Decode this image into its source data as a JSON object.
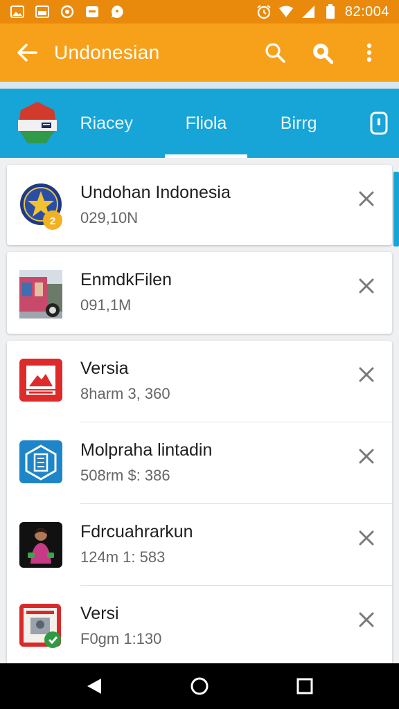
{
  "status_bar": {
    "time": "82:004",
    "left_icons": [
      "image-icon",
      "gallery-icon",
      "whatsapp-icon",
      "mail-icon",
      "chat-icon"
    ],
    "right_icons": [
      "alarm-icon",
      "wifi-icon",
      "signal-icon",
      "battery-icon"
    ]
  },
  "app_bar": {
    "title": "Undonesian",
    "back_icon": "arrow-back-icon",
    "actions": [
      "search-icon",
      "search-filled-icon",
      "more-vert-icon"
    ]
  },
  "tabs": {
    "items": [
      {
        "label": "Riacey"
      },
      {
        "label": "Fliola",
        "selected": true
      },
      {
        "label": "Birrg"
      }
    ]
  },
  "cards": [
    {
      "items": [
        {
          "title": "Undohan Indonesia",
          "subtitle": "029,10N",
          "icon": "indonesia-emblem-icon"
        }
      ]
    },
    {
      "items": [
        {
          "title": "EnmdkFilen",
          "subtitle": "091,1M",
          "icon": "building-photo-icon"
        }
      ]
    },
    {
      "items": [
        {
          "title": "Versia",
          "subtitle": "8harm 3, 360",
          "icon": "red-mountain-icon"
        },
        {
          "title": "Molpraha lintadin",
          "subtitle": "508rm $: 386",
          "icon": "blue-document-icon"
        },
        {
          "title": "Fdrcuahrarkun",
          "subtitle": "124m 1: 583",
          "icon": "person-photo-icon"
        },
        {
          "title": "Versi",
          "subtitle": "F0gm 1:130",
          "icon": "red-book-icon"
        }
      ]
    }
  ],
  "nav_bar": {
    "buttons": [
      "back-triangle-icon",
      "home-circle-icon",
      "recents-square-icon"
    ]
  },
  "colors": {
    "status_bar": "#ea8a0c",
    "app_bar": "#f7a11a",
    "tab_bar": "#17a4d6",
    "background": "#eef0f2"
  }
}
